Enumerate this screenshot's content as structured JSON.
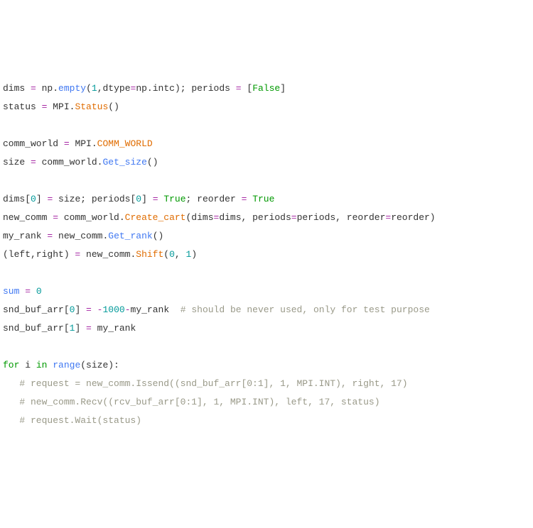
{
  "lines": [
    {
      "segs": [
        {
          "t": "dims ",
          "c": "s-id"
        },
        {
          "t": "=",
          "c": "s-op"
        },
        {
          "t": " np",
          "c": "s-id"
        },
        {
          "t": ".",
          "c": "s-punc"
        },
        {
          "t": "empty",
          "c": "s-fn"
        },
        {
          "t": "(",
          "c": "s-punc"
        },
        {
          "t": "1",
          "c": "s-num"
        },
        {
          "t": ",dtype",
          "c": "s-id"
        },
        {
          "t": "=",
          "c": "s-op"
        },
        {
          "t": "np",
          "c": "s-id"
        },
        {
          "t": ".",
          "c": "s-punc"
        },
        {
          "t": "intc",
          "c": "s-id"
        },
        {
          "t": "); periods ",
          "c": "s-id"
        },
        {
          "t": "=",
          "c": "s-op"
        },
        {
          "t": " [",
          "c": "s-punc"
        },
        {
          "t": "False",
          "c": "s-bool"
        },
        {
          "t": "]",
          "c": "s-punc"
        }
      ]
    },
    {
      "segs": [
        {
          "t": "status ",
          "c": "s-id"
        },
        {
          "t": "=",
          "c": "s-op"
        },
        {
          "t": " MPI",
          "c": "s-id"
        },
        {
          "t": ".",
          "c": "s-punc"
        },
        {
          "t": "Status",
          "c": "s-const"
        },
        {
          "t": "()",
          "c": "s-punc"
        }
      ]
    },
    {
      "segs": [
        {
          "t": " ",
          "c": "s-id"
        }
      ]
    },
    {
      "segs": [
        {
          "t": "comm_world ",
          "c": "s-id"
        },
        {
          "t": "=",
          "c": "s-op"
        },
        {
          "t": " MPI",
          "c": "s-id"
        },
        {
          "t": ".",
          "c": "s-punc"
        },
        {
          "t": "COMM_WORLD",
          "c": "s-const"
        }
      ]
    },
    {
      "segs": [
        {
          "t": "size ",
          "c": "s-id"
        },
        {
          "t": "=",
          "c": "s-op"
        },
        {
          "t": " comm_world",
          "c": "s-id"
        },
        {
          "t": ".",
          "c": "s-punc"
        },
        {
          "t": "Get_size",
          "c": "s-fn"
        },
        {
          "t": "()",
          "c": "s-punc"
        }
      ]
    },
    {
      "segs": [
        {
          "t": " ",
          "c": "s-id"
        }
      ]
    },
    {
      "segs": [
        {
          "t": "dims[",
          "c": "s-id"
        },
        {
          "t": "0",
          "c": "s-num"
        },
        {
          "t": "] ",
          "c": "s-id"
        },
        {
          "t": "=",
          "c": "s-op"
        },
        {
          "t": " size; periods[",
          "c": "s-id"
        },
        {
          "t": "0",
          "c": "s-num"
        },
        {
          "t": "] ",
          "c": "s-id"
        },
        {
          "t": "=",
          "c": "s-op"
        },
        {
          "t": " ",
          "c": "s-id"
        },
        {
          "t": "True",
          "c": "s-bool"
        },
        {
          "t": "; reorder ",
          "c": "s-id"
        },
        {
          "t": "=",
          "c": "s-op"
        },
        {
          "t": " ",
          "c": "s-id"
        },
        {
          "t": "True",
          "c": "s-bool"
        }
      ]
    },
    {
      "segs": [
        {
          "t": "new_comm ",
          "c": "s-id"
        },
        {
          "t": "=",
          "c": "s-op"
        },
        {
          "t": " comm_world",
          "c": "s-id"
        },
        {
          "t": ".",
          "c": "s-punc"
        },
        {
          "t": "Create_cart",
          "c": "s-const"
        },
        {
          "t": "(dims",
          "c": "s-id"
        },
        {
          "t": "=",
          "c": "s-op"
        },
        {
          "t": "dims, periods",
          "c": "s-id"
        },
        {
          "t": "=",
          "c": "s-op"
        },
        {
          "t": "periods, reorder",
          "c": "s-id"
        },
        {
          "t": "=",
          "c": "s-op"
        },
        {
          "t": "reorder)",
          "c": "s-id"
        }
      ]
    },
    {
      "segs": [
        {
          "t": "my_rank ",
          "c": "s-id"
        },
        {
          "t": "=",
          "c": "s-op"
        },
        {
          "t": " new_comm",
          "c": "s-id"
        },
        {
          "t": ".",
          "c": "s-punc"
        },
        {
          "t": "Get_rank",
          "c": "s-fn"
        },
        {
          "t": "()",
          "c": "s-punc"
        }
      ]
    },
    {
      "segs": [
        {
          "t": "(left,right) ",
          "c": "s-id"
        },
        {
          "t": "=",
          "c": "s-op"
        },
        {
          "t": " new_comm",
          "c": "s-id"
        },
        {
          "t": ".",
          "c": "s-punc"
        },
        {
          "t": "Shift",
          "c": "s-const"
        },
        {
          "t": "(",
          "c": "s-punc"
        },
        {
          "t": "0",
          "c": "s-num"
        },
        {
          "t": ", ",
          "c": "s-id"
        },
        {
          "t": "1",
          "c": "s-num"
        },
        {
          "t": ")",
          "c": "s-punc"
        }
      ]
    },
    {
      "segs": [
        {
          "t": " ",
          "c": "s-id"
        }
      ]
    },
    {
      "segs": [
        {
          "t": "sum",
          "c": "s-fn"
        },
        {
          "t": " ",
          "c": "s-id"
        },
        {
          "t": "=",
          "c": "s-op"
        },
        {
          "t": " ",
          "c": "s-id"
        },
        {
          "t": "0",
          "c": "s-num"
        }
      ]
    },
    {
      "segs": [
        {
          "t": "snd_buf_arr[",
          "c": "s-id"
        },
        {
          "t": "0",
          "c": "s-num"
        },
        {
          "t": "] ",
          "c": "s-id"
        },
        {
          "t": "=",
          "c": "s-op"
        },
        {
          "t": " ",
          "c": "s-id"
        },
        {
          "t": "-",
          "c": "s-op"
        },
        {
          "t": "1000",
          "c": "s-num"
        },
        {
          "t": "-",
          "c": "s-op"
        },
        {
          "t": "my_rank  ",
          "c": "s-id"
        },
        {
          "t": "# should be never used, only for test purpose",
          "c": "s-cmt"
        }
      ]
    },
    {
      "segs": [
        {
          "t": "snd_buf_arr[",
          "c": "s-id"
        },
        {
          "t": "1",
          "c": "s-num"
        },
        {
          "t": "] ",
          "c": "s-id"
        },
        {
          "t": "=",
          "c": "s-op"
        },
        {
          "t": " my_rank",
          "c": "s-id"
        }
      ]
    },
    {
      "segs": [
        {
          "t": " ",
          "c": "s-id"
        }
      ]
    },
    {
      "segs": [
        {
          "t": "for",
          "c": "s-kw"
        },
        {
          "t": " i ",
          "c": "s-id"
        },
        {
          "t": "in",
          "c": "s-kw"
        },
        {
          "t": " ",
          "c": "s-id"
        },
        {
          "t": "range",
          "c": "s-fn"
        },
        {
          "t": "(size):",
          "c": "s-id"
        }
      ]
    },
    {
      "segs": [
        {
          "t": "   ",
          "c": "s-id"
        },
        {
          "t": "# request = new_comm.Issend((snd_buf_arr[0:1], 1, MPI.INT), right, 17)",
          "c": "s-cmt"
        }
      ]
    },
    {
      "segs": [
        {
          "t": "   ",
          "c": "s-id"
        },
        {
          "t": "# new_comm.Recv((rcv_buf_arr[0:1], 1, MPI.INT), left, 17, status)",
          "c": "s-cmt"
        }
      ]
    },
    {
      "segs": [
        {
          "t": "   ",
          "c": "s-id"
        },
        {
          "t": "# request.Wait(status)",
          "c": "s-cmt"
        }
      ]
    }
  ]
}
